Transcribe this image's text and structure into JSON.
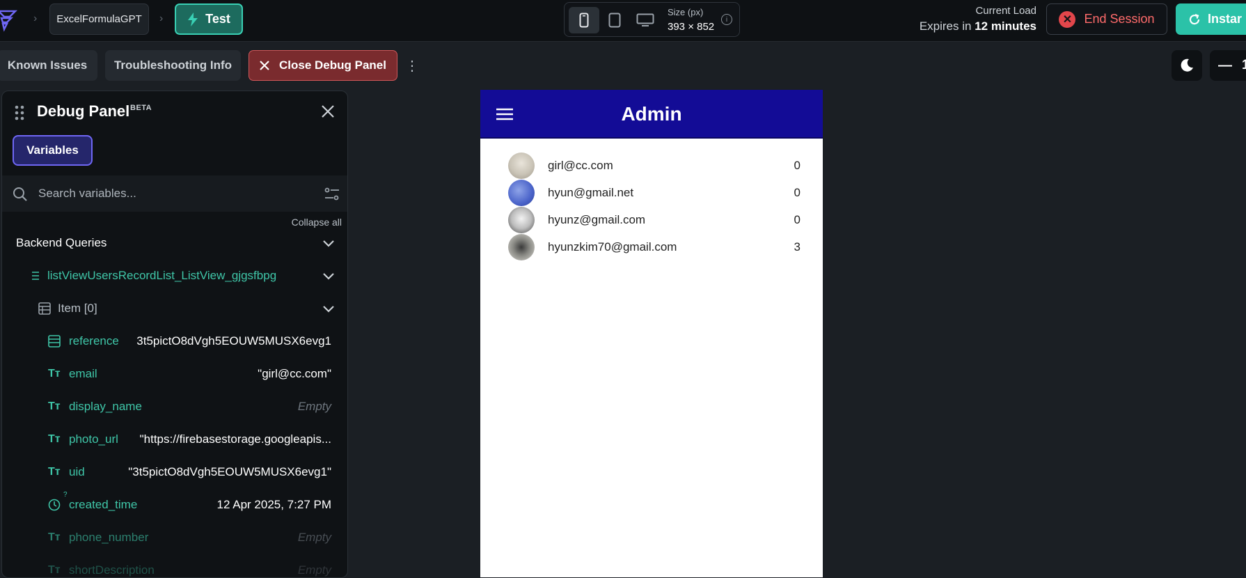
{
  "topbar": {
    "project_name": "ExcelFormulaGPT",
    "test_label": "Test",
    "size_label": "Size (px)",
    "size_value": "393 × 852",
    "current_load_label": "Current Load",
    "expires_prefix": "Expires in",
    "expires_value": "12 minutes",
    "end_session_label": "End Session",
    "instant_label": "Instar"
  },
  "secondary_bar": {
    "known_issues_label": "Known Issues",
    "troubleshooting_label": "Troubleshooting Info",
    "close_debug_label": "Close Debug Panel",
    "zoom_value": "1("
  },
  "debug_panel": {
    "title": "Debug Panel",
    "badge": "BETA",
    "variables_tab": "Variables",
    "search_placeholder": "Search variables...",
    "collapse_all": "Collapse all",
    "section": "Backend Queries",
    "query_name": "listViewUsersRecordList_ListView_gjgsfbpg",
    "item_label": "Item [0]",
    "fields": [
      {
        "name": "reference",
        "value": "3t5pictO8dVgh5EOUW5MUSX6evg1",
        "empty": false
      },
      {
        "name": "email",
        "value": "\"girl@cc.com\"",
        "empty": false
      },
      {
        "name": "display_name",
        "value": "Empty",
        "empty": true
      },
      {
        "name": "photo_url",
        "value": "\"https://firebasestorage.googleapis...",
        "empty": false
      },
      {
        "name": "uid",
        "value": "\"3t5pictO8dVgh5EOUW5MUSX6evg1\"",
        "empty": false
      },
      {
        "name": "created_time",
        "value": "12 Apr 2025, 7:27 PM",
        "empty": false
      },
      {
        "name": "phone_number",
        "value": "Empty",
        "empty": true
      },
      {
        "name": "shortDescription",
        "value": "Empty",
        "empty": true
      }
    ]
  },
  "app": {
    "title": "Admin",
    "users": [
      {
        "email": "girl@cc.com",
        "count": "0"
      },
      {
        "email": "hyun@gmail.net",
        "count": "0"
      },
      {
        "email": "hyunz@gmail.com",
        "count": "0"
      },
      {
        "email": "hyunzkim70@gmail.com",
        "count": "3"
      }
    ]
  },
  "colors": {
    "accent_teal": "#39d0b4",
    "danger": "#e2464b",
    "app_header": "#130c96",
    "variables_accent": "#6f67f5"
  }
}
